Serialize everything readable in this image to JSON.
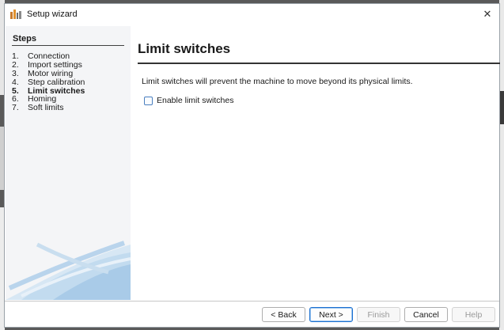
{
  "window": {
    "title": "Setup wizard",
    "close_glyph": "✕"
  },
  "steps": {
    "heading": "Steps",
    "items": [
      {
        "num": "1.",
        "label": "Connection",
        "active": false
      },
      {
        "num": "2.",
        "label": "Import settings",
        "active": false
      },
      {
        "num": "3.",
        "label": "Motor wiring",
        "active": false
      },
      {
        "num": "4.",
        "label": "Step calibration",
        "active": false
      },
      {
        "num": "5.",
        "label": "Limit switches",
        "active": true
      },
      {
        "num": "6.",
        "label": "Homing",
        "active": false
      },
      {
        "num": "7.",
        "label": "Soft limits",
        "active": false
      }
    ]
  },
  "main": {
    "title": "Limit switches",
    "description": "Limit switches will prevent the machine to move beyond its physical limits.",
    "checkbox_label": "Enable limit switches",
    "checkbox_checked": false
  },
  "buttons": {
    "back": "< Back",
    "next": "Next >",
    "finish": "Finish",
    "cancel": "Cancel",
    "help": "Help"
  },
  "colors": {
    "accent": "#1a6fd0",
    "checkbox_border": "#4a7fbf",
    "steps_panel_bg": "#f4f5f7"
  }
}
